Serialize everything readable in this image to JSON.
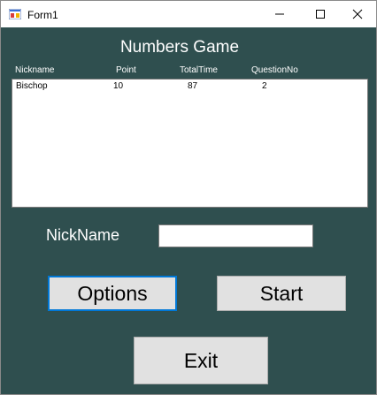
{
  "window": {
    "title": "Form1",
    "controls": [
      "minimize-icon",
      "maximize-icon",
      "close-icon"
    ]
  },
  "game": {
    "title": "Numbers Game"
  },
  "list": {
    "headers": [
      "Nickname",
      "Point",
      "TotalTime",
      "QuestionNo"
    ],
    "rows": [
      {
        "nickname": "Bischop",
        "point": "10",
        "total_time": "87",
        "question_no": "2"
      }
    ]
  },
  "nickname": {
    "label": "NickName",
    "value": ""
  },
  "buttons": {
    "options": "Options",
    "start": "Start",
    "exit": "Exit"
  },
  "colors": {
    "background": "#2f4f4f",
    "button": "#e1e1e1",
    "focus_border": "#0078d7"
  }
}
